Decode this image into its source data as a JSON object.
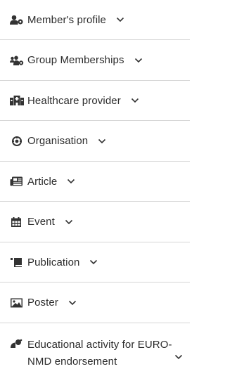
{
  "menu": {
    "items": [
      {
        "label": "Member's profile",
        "icon": "user-gear-icon"
      },
      {
        "label": "Group Memberships",
        "icon": "users-gear-icon"
      },
      {
        "label": "Healthcare provider",
        "icon": "hospital-icon"
      },
      {
        "label": "Organisation",
        "icon": "organisation-icon"
      },
      {
        "label": "Article",
        "icon": "newspaper-icon"
      },
      {
        "label": "Event",
        "icon": "calendar-icon"
      },
      {
        "label": "Publication",
        "icon": "book-icon"
      },
      {
        "label": "Poster",
        "icon": "image-icon"
      },
      {
        "label": "Educational activity for EURO-NMD endorsement",
        "icon": "satellite-dish-icon"
      }
    ],
    "chevron_icon": "chevron-down-icon"
  }
}
